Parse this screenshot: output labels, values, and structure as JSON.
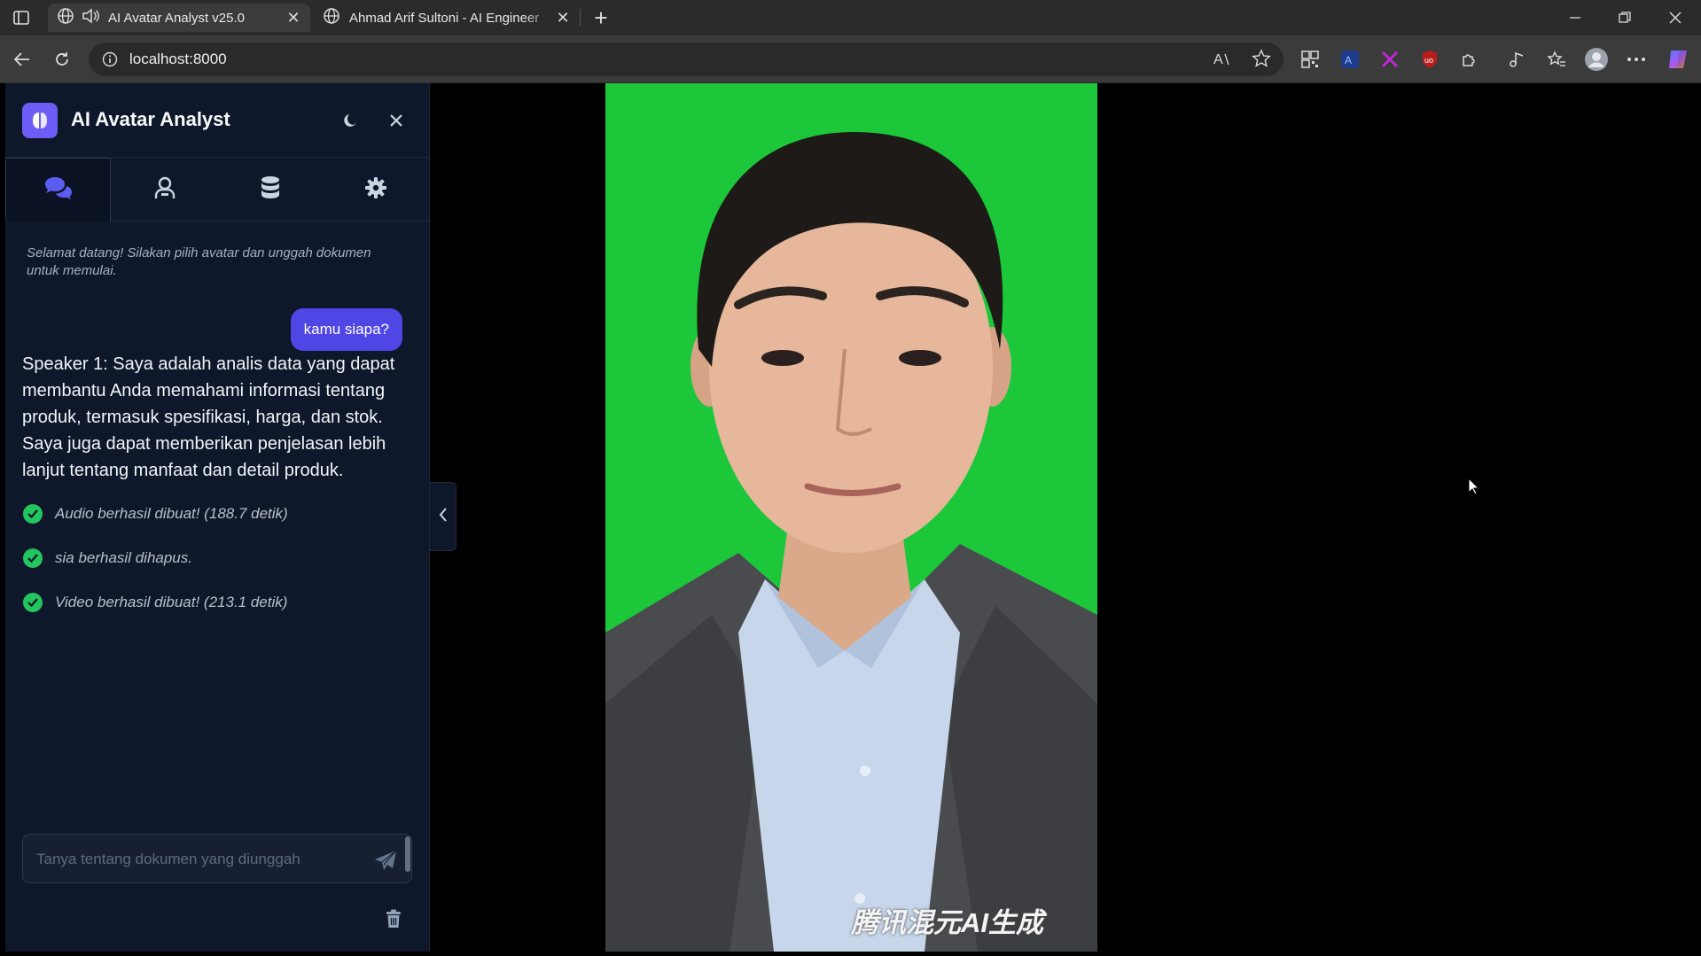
{
  "browser": {
    "tabs": [
      {
        "title": "AI Avatar Analyst v25.0",
        "active": true,
        "audio": true
      },
      {
        "title": "Ahmad Arif Sultoni - AI Engineer",
        "active": false,
        "audio": false
      }
    ],
    "url": "localhost:8000",
    "icons": {
      "tab_actions": "tab-actions-icon",
      "back": "back-icon",
      "refresh": "refresh-icon",
      "site_info": "info-icon",
      "read_aloud": "read-aloud-icon",
      "favorite": "star-icon",
      "extensions": "puzzle-icon",
      "profile": "profile-icon",
      "more": "more-icon",
      "copilot": "copilot-icon"
    }
  },
  "app": {
    "title": "AI Avatar Analyst",
    "accent_color": "#4f46e5",
    "sidebar_bg": "#0f172a",
    "tabs": [
      {
        "icon": "chat-icon",
        "active": true
      },
      {
        "icon": "avatar-icon",
        "active": false
      },
      {
        "icon": "database-icon",
        "active": false
      },
      {
        "icon": "gear-icon",
        "active": false
      }
    ],
    "chat": {
      "welcome": "Selamat datang! Silakan pilih avatar dan unggah dokumen untuk memulai.",
      "user_message": "kamu siapa?",
      "bot_message": "Speaker 1: Saya adalah analis data yang dapat membantu Anda memahami informasi tentang produk, termasuk spesifikasi, harga, dan stok. Saya juga dapat memberikan penjelasan lebih lanjut tentang manfaat dan detail produk.",
      "status_messages": [
        "Audio berhasil dibuat! (188.7 detik)",
        "sia berhasil dihapus.",
        "Video berhasil dibuat! (213.1 detik)"
      ],
      "status_color": "#22c55e"
    },
    "input": {
      "placeholder": "Tanya tentang dokumen yang diunggah"
    }
  },
  "video": {
    "background_color": "#1cc73a",
    "watermark": "腾讯混元AI生成"
  }
}
